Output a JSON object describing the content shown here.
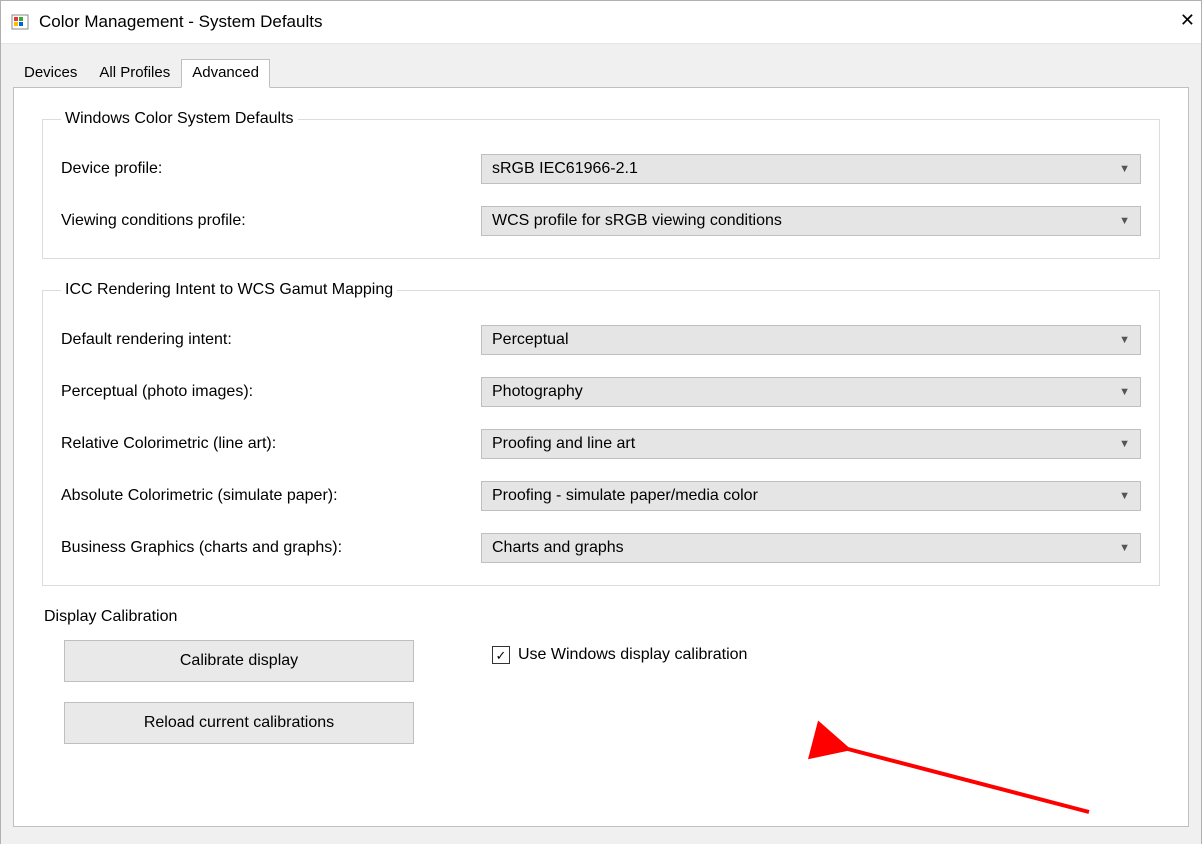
{
  "window_title": "Color Management - System Defaults",
  "tabs": {
    "devices": "Devices",
    "all_profiles": "All Profiles",
    "advanced": "Advanced"
  },
  "group_wcs": {
    "legend": "Windows Color System Defaults",
    "device_profile_label": "Device profile:",
    "device_profile_value": "sRGB IEC61966-2.1",
    "viewing_label": "Viewing conditions profile:",
    "viewing_value": "WCS profile for sRGB viewing conditions"
  },
  "group_icc": {
    "legend": "ICC Rendering Intent to WCS Gamut Mapping",
    "default_intent_label": "Default rendering intent:",
    "default_intent_value": "Perceptual",
    "perceptual_label": "Perceptual (photo images):",
    "perceptual_value": "Photography",
    "relative_label": "Relative Colorimetric (line art):",
    "relative_value": "Proofing and line art",
    "absolute_label": "Absolute Colorimetric (simulate paper):",
    "absolute_value": "Proofing - simulate paper/media color",
    "business_label": "Business Graphics (charts and graphs):",
    "business_value": "Charts and graphs"
  },
  "group_calib": {
    "legend": "Display Calibration",
    "calibrate_btn": "Calibrate display",
    "reload_btn": "Reload current calibrations",
    "checkbox_label": "Use Windows display calibration",
    "checkbox_checked": true
  }
}
